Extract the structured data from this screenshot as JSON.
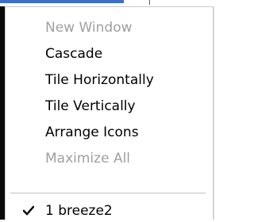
{
  "colors": {
    "accent": "#3f6fc6",
    "disabled_text": "#a0a0a0",
    "enabled_text": "#000000"
  },
  "menu": {
    "items": [
      {
        "label": "New Window",
        "enabled": false
      },
      {
        "label": "Cascade",
        "enabled": true
      },
      {
        "label": "Tile Horizontally",
        "enabled": true
      },
      {
        "label": "Tile Vertically",
        "enabled": true
      },
      {
        "label": "Arrange Icons",
        "enabled": true
      },
      {
        "label": "Maximize All",
        "enabled": false
      }
    ],
    "windows": [
      {
        "label": "1 breeze2",
        "checked": true,
        "icon": "checkmark-icon"
      }
    ]
  }
}
